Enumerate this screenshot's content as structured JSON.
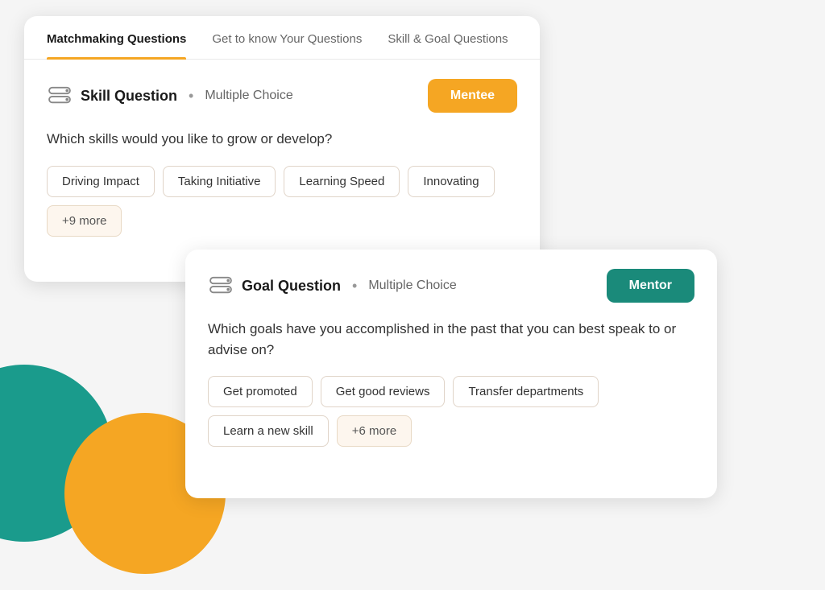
{
  "colors": {
    "teal": "#1a9b8c",
    "orange": "#f5a623",
    "mentor_green": "#1a8a7a"
  },
  "card1": {
    "tabs": [
      {
        "id": "matchmaking",
        "label": "Matchmaking Questions",
        "active": true
      },
      {
        "id": "gettoknow",
        "label": "Get to know Your Questions",
        "active": false
      },
      {
        "id": "skillandgoal",
        "label": "Skill & Goal Questions",
        "active": false
      }
    ],
    "question": {
      "type_label": "Skill Question",
      "separator": "•",
      "format": "Multiple Choice",
      "role_badge": "Mentee",
      "text": "Which skills would you like to grow or develop?",
      "tags": [
        {
          "label": "Driving Impact"
        },
        {
          "label": "Taking Initiative"
        },
        {
          "label": "Learning Speed"
        },
        {
          "label": "Innovating"
        }
      ],
      "more_label": "+9 more"
    }
  },
  "card2": {
    "question": {
      "type_label": "Goal Question",
      "separator": "•",
      "format": "Multiple Choice",
      "role_badge": "Mentor",
      "text": "Which goals have you accomplished in the past that you can best speak to or advise on?",
      "tags": [
        {
          "label": "Get promoted"
        },
        {
          "label": "Get good reviews"
        },
        {
          "label": "Transfer departments"
        }
      ],
      "tags_row2": [
        {
          "label": "Learn a new skill"
        },
        {
          "label": "+6 more",
          "extra": true
        }
      ],
      "more_label": "+6 more"
    }
  }
}
